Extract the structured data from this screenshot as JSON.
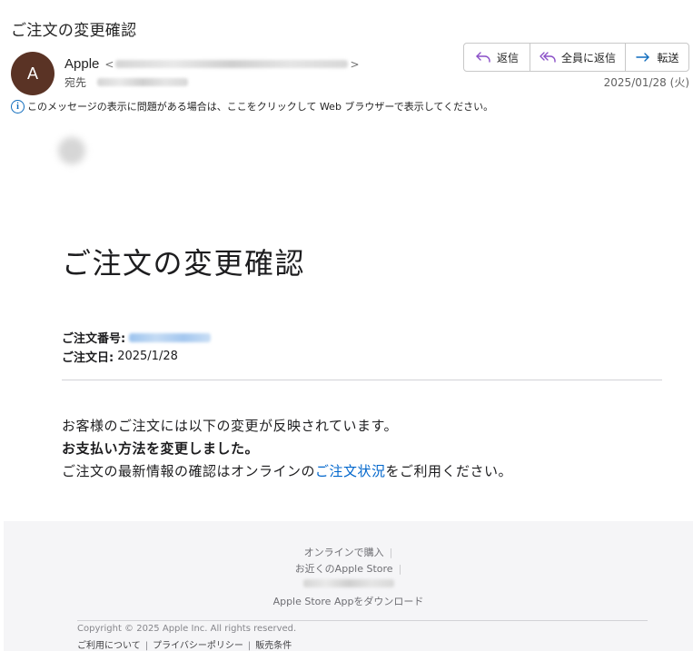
{
  "email": {
    "subject": "ご注文の変更確認",
    "avatar_initial": "A",
    "sender_name": "Apple",
    "email_open": "<",
    "email_close": ">",
    "to_label": "宛先",
    "date": "2025/01/28 (火)",
    "info_icon": "i",
    "info_text": "このメッセージの表示に問題がある場合は、ここをクリックして Web ブラウザーで表示してください。"
  },
  "actions": {
    "reply": "返信",
    "reply_all": "全員に返信",
    "forward": "転送"
  },
  "content": {
    "title": "ご注文の変更確認",
    "order_number_label": "ご注文番号:",
    "order_date_label": "ご注文日:",
    "order_date": "2025/1/28",
    "line1": "お客様のご注文には以下の変更が反映されています。",
    "line2": "お支払い方法を変更しました。",
    "line3_before": "ご注文の最新情報の確認はオンラインの",
    "line3_link": "ご注文状況",
    "line3_after": "をご利用ください。"
  },
  "footer": {
    "buy_online": "オンラインで購入",
    "nearby_store": "お近くのApple Store",
    "download_app": "Apple Store Appをダウンロード",
    "separator": "|",
    "copyright": "Copyright © 2025 Apple Inc. All rights reserved.",
    "terms": "ご利用について",
    "privacy": "プライバシーポリシー",
    "sales": "販売条件"
  },
  "colors": {
    "accent": "#0f6cbd",
    "link": "#0066cc",
    "avatar_bg": "#5a3325",
    "reply_all_icon": "#8a4fc7"
  },
  "icons": {
    "reply": "reply-arrow-icon",
    "reply_all": "reply-all-arrow-icon",
    "forward": "forward-arrow-icon",
    "info": "info-circle-icon"
  }
}
